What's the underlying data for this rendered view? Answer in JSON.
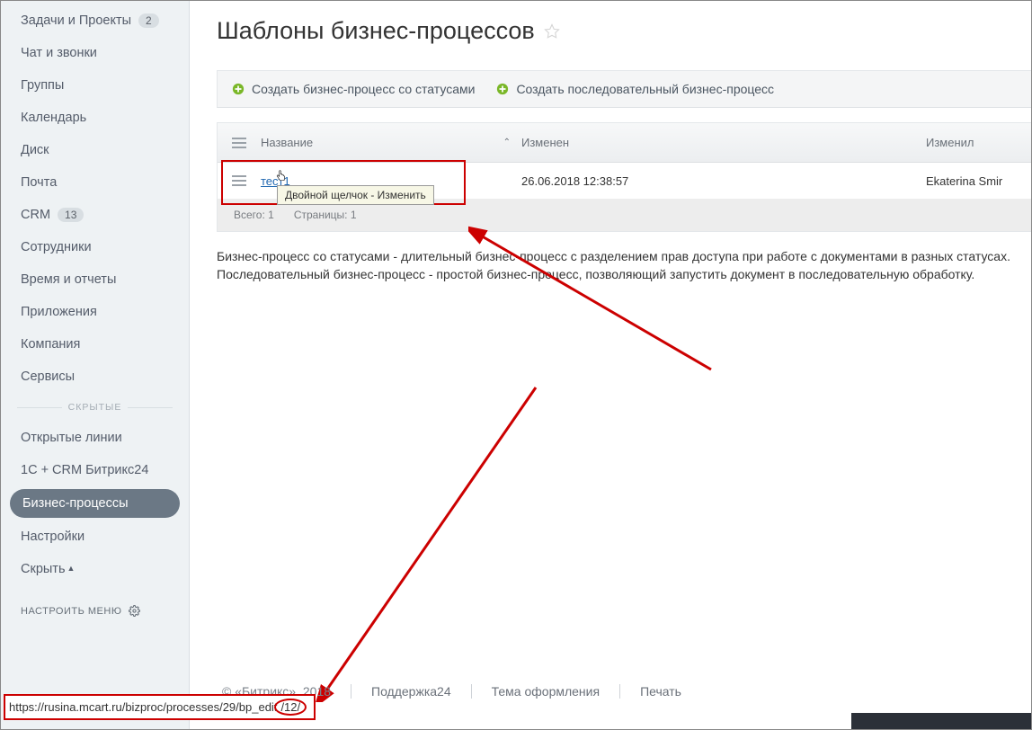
{
  "sidebar": {
    "items": [
      {
        "label": "Задачи и Проекты",
        "badge": "2"
      },
      {
        "label": "Чат и звонки"
      },
      {
        "label": "Группы"
      },
      {
        "label": "Календарь"
      },
      {
        "label": "Диск"
      },
      {
        "label": "Почта"
      },
      {
        "label": "CRM",
        "badge": "13"
      },
      {
        "label": "Сотрудники"
      },
      {
        "label": "Время и отчеты"
      },
      {
        "label": "Приложения"
      },
      {
        "label": "Компания"
      },
      {
        "label": "Сервисы"
      }
    ],
    "hidden_label": "СКРЫТЫЕ",
    "hidden_items": [
      {
        "label": "Открытые линии"
      },
      {
        "label": "1С + CRM Битрикс24"
      },
      {
        "label": "Бизнес-процессы",
        "active": true
      },
      {
        "label": "Настройки"
      },
      {
        "label": "Скрыть"
      }
    ],
    "configure": "НАСТРОИТЬ МЕНЮ"
  },
  "page": {
    "title": "Шаблоны бизнес-процессов"
  },
  "toolbar": {
    "create_status": "Создать бизнес-процесс со статусами",
    "create_sequential": "Создать последовательный бизнес-процесс"
  },
  "grid": {
    "headers": {
      "name": "Название",
      "modified": "Изменен",
      "author": "Изменил"
    },
    "rows": [
      {
        "name": "тест1",
        "modified": "26.06.2018 12:38:57",
        "author": "Ekaterina Smir"
      }
    ],
    "footer": {
      "total_label": "Всего:",
      "total_value": "1",
      "pages_label": "Страницы:",
      "pages_value": "1"
    },
    "tooltip": "Двойной щелчок - Изменить"
  },
  "description": {
    "line1": "Бизнес-процесс со статусами - длительный бизнес-процесс с разделением прав доступа при работе с документами в разных статусах.",
    "line2": "Последовательный бизнес-процесс - простой бизнес-процесс, позволяющий запустить документ в последовательную обработку."
  },
  "footer": {
    "copyright": "© «Битрикс», 2018",
    "support": "Поддержка24",
    "theme": "Тема оформления",
    "print": "Печать"
  },
  "url": {
    "prefix": "https://rusina.mcart.ru/bizproc/processes/29/bp_edit",
    "highlight": "/12/"
  }
}
